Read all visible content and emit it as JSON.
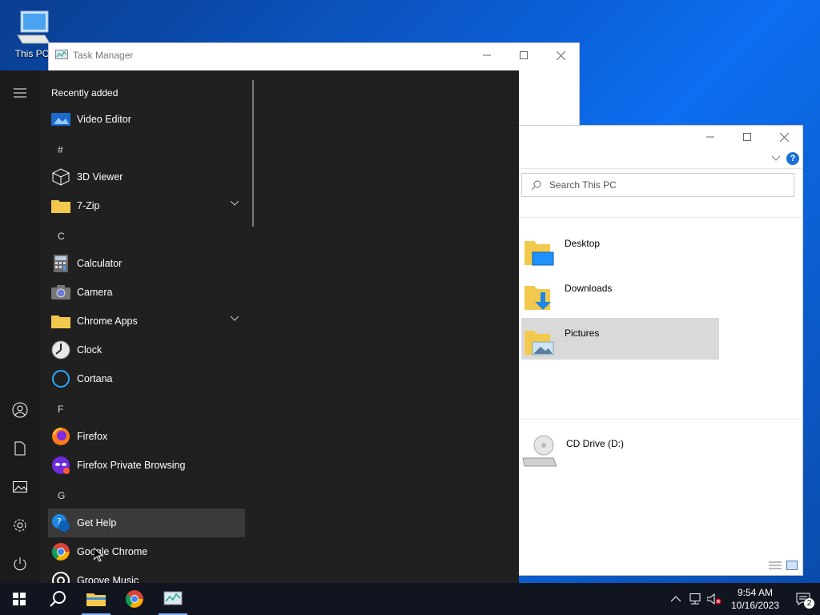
{
  "desktop": {
    "this_pc_label": "This PC"
  },
  "task_manager": {
    "title": "Task Manager"
  },
  "explorer": {
    "search_placeholder": "Search This PC",
    "folders": [
      "Desktop",
      "Downloads",
      "Pictures"
    ],
    "selected_folder": "Pictures",
    "drive_label": "CD Drive (D:)"
  },
  "start_menu": {
    "recently_added_heading": "Recently added",
    "recent_app": "Video Editor",
    "sections": {
      "hash": "#",
      "c": "C",
      "f": "F",
      "g": "G"
    },
    "apps": {
      "viewer_3d": "3D Viewer",
      "seven_zip": "7-Zip",
      "calculator": "Calculator",
      "camera": "Camera",
      "chrome_apps": "Chrome Apps",
      "clock": "Clock",
      "cortana": "Cortana",
      "firefox": "Firefox",
      "firefox_private": "Firefox Private Browsing",
      "get_help": "Get Help",
      "google_chrome": "Google Chrome",
      "groove_music": "Groove Music"
    },
    "hovered_app": "Get Help"
  },
  "taskbar": {
    "time": "9:54 AM",
    "date": "10/16/2023",
    "notification_count": "2",
    "accent_color": "#7fb2ff"
  }
}
